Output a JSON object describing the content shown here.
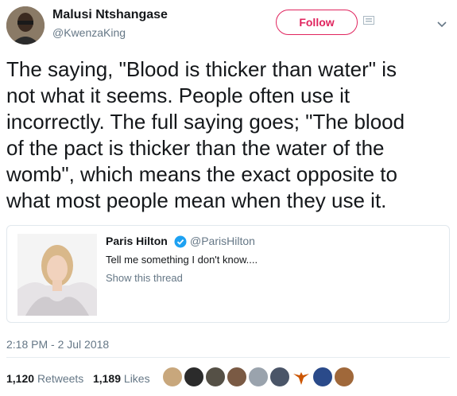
{
  "header": {
    "name": "Malusi Ntshangase",
    "handle": "@KwenzaKing",
    "follow_label": "Follow",
    "colors": {
      "accent": "#e0245e",
      "secondary_text": "#657786"
    }
  },
  "tweet": {
    "text": "The saying, \"Blood is thicker than water\" is\nnot what it seems. People often use it\nincorrectly. The full saying goes; \"The blood\nof the pact is thicker than the water of the\nwomb\", which means the exact opposite to\nwhat most people mean when they use it."
  },
  "quoted_tweet": {
    "name": "Paris Hilton",
    "verified_icon": "verified-badge-icon",
    "handle": "@ParisHilton",
    "text": "Tell me something I don't know....",
    "show_thread": "Show this thread"
  },
  "timestamp": "2:18 PM - 2 Jul 2018",
  "stats": {
    "retweets_count": "1,120",
    "retweets_label": "Retweets",
    "likes_count": "1,189",
    "likes_label": "Likes"
  },
  "liker_avatars": [
    "liker-1",
    "liker-2",
    "liker-3",
    "liker-4",
    "liker-5",
    "liker-6",
    "liker-7",
    "liker-8",
    "liker-9",
    "liker-10"
  ]
}
